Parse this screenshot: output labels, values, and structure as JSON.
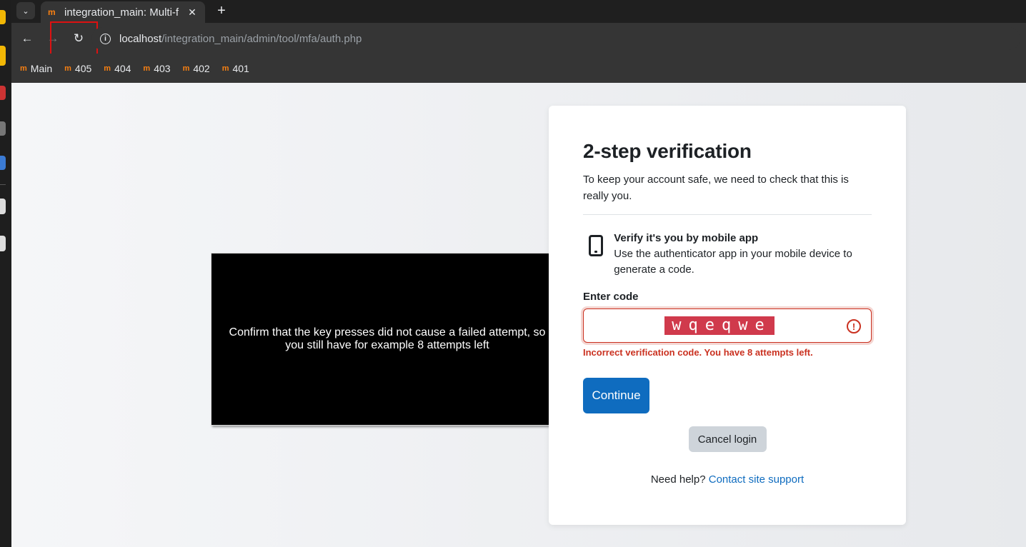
{
  "browser": {
    "tab_title": "integration_main: Multi-f",
    "url_host": "localhost",
    "url_path": "/integration_main/admin/tool/mfa/auth.php",
    "bookmarks": [
      "Main",
      "405",
      "404",
      "403",
      "402",
      "401"
    ]
  },
  "overlay": {
    "text": "Confirm that the key presses did not cause a failed attempt, so you still have for example 8 attempts left"
  },
  "mfa": {
    "title": "2-step verification",
    "intro": "To keep your account safe, we need to check that this is really you.",
    "factor_title": "Verify it's you by mobile app",
    "factor_desc": "Use the authenticator app in your mobile device to generate a code.",
    "code_label": "Enter code",
    "code_value": "wqeqwe",
    "error": "Incorrect verification code. You have 8 attempts left.",
    "continue_label": "Continue",
    "cancel_label": "Cancel login",
    "help_text": "Need help?",
    "help_link": "Contact site support"
  },
  "colors": {
    "primary": "#0f6cbf",
    "danger": "#ca3120",
    "moodle_orange": "#f98012"
  }
}
